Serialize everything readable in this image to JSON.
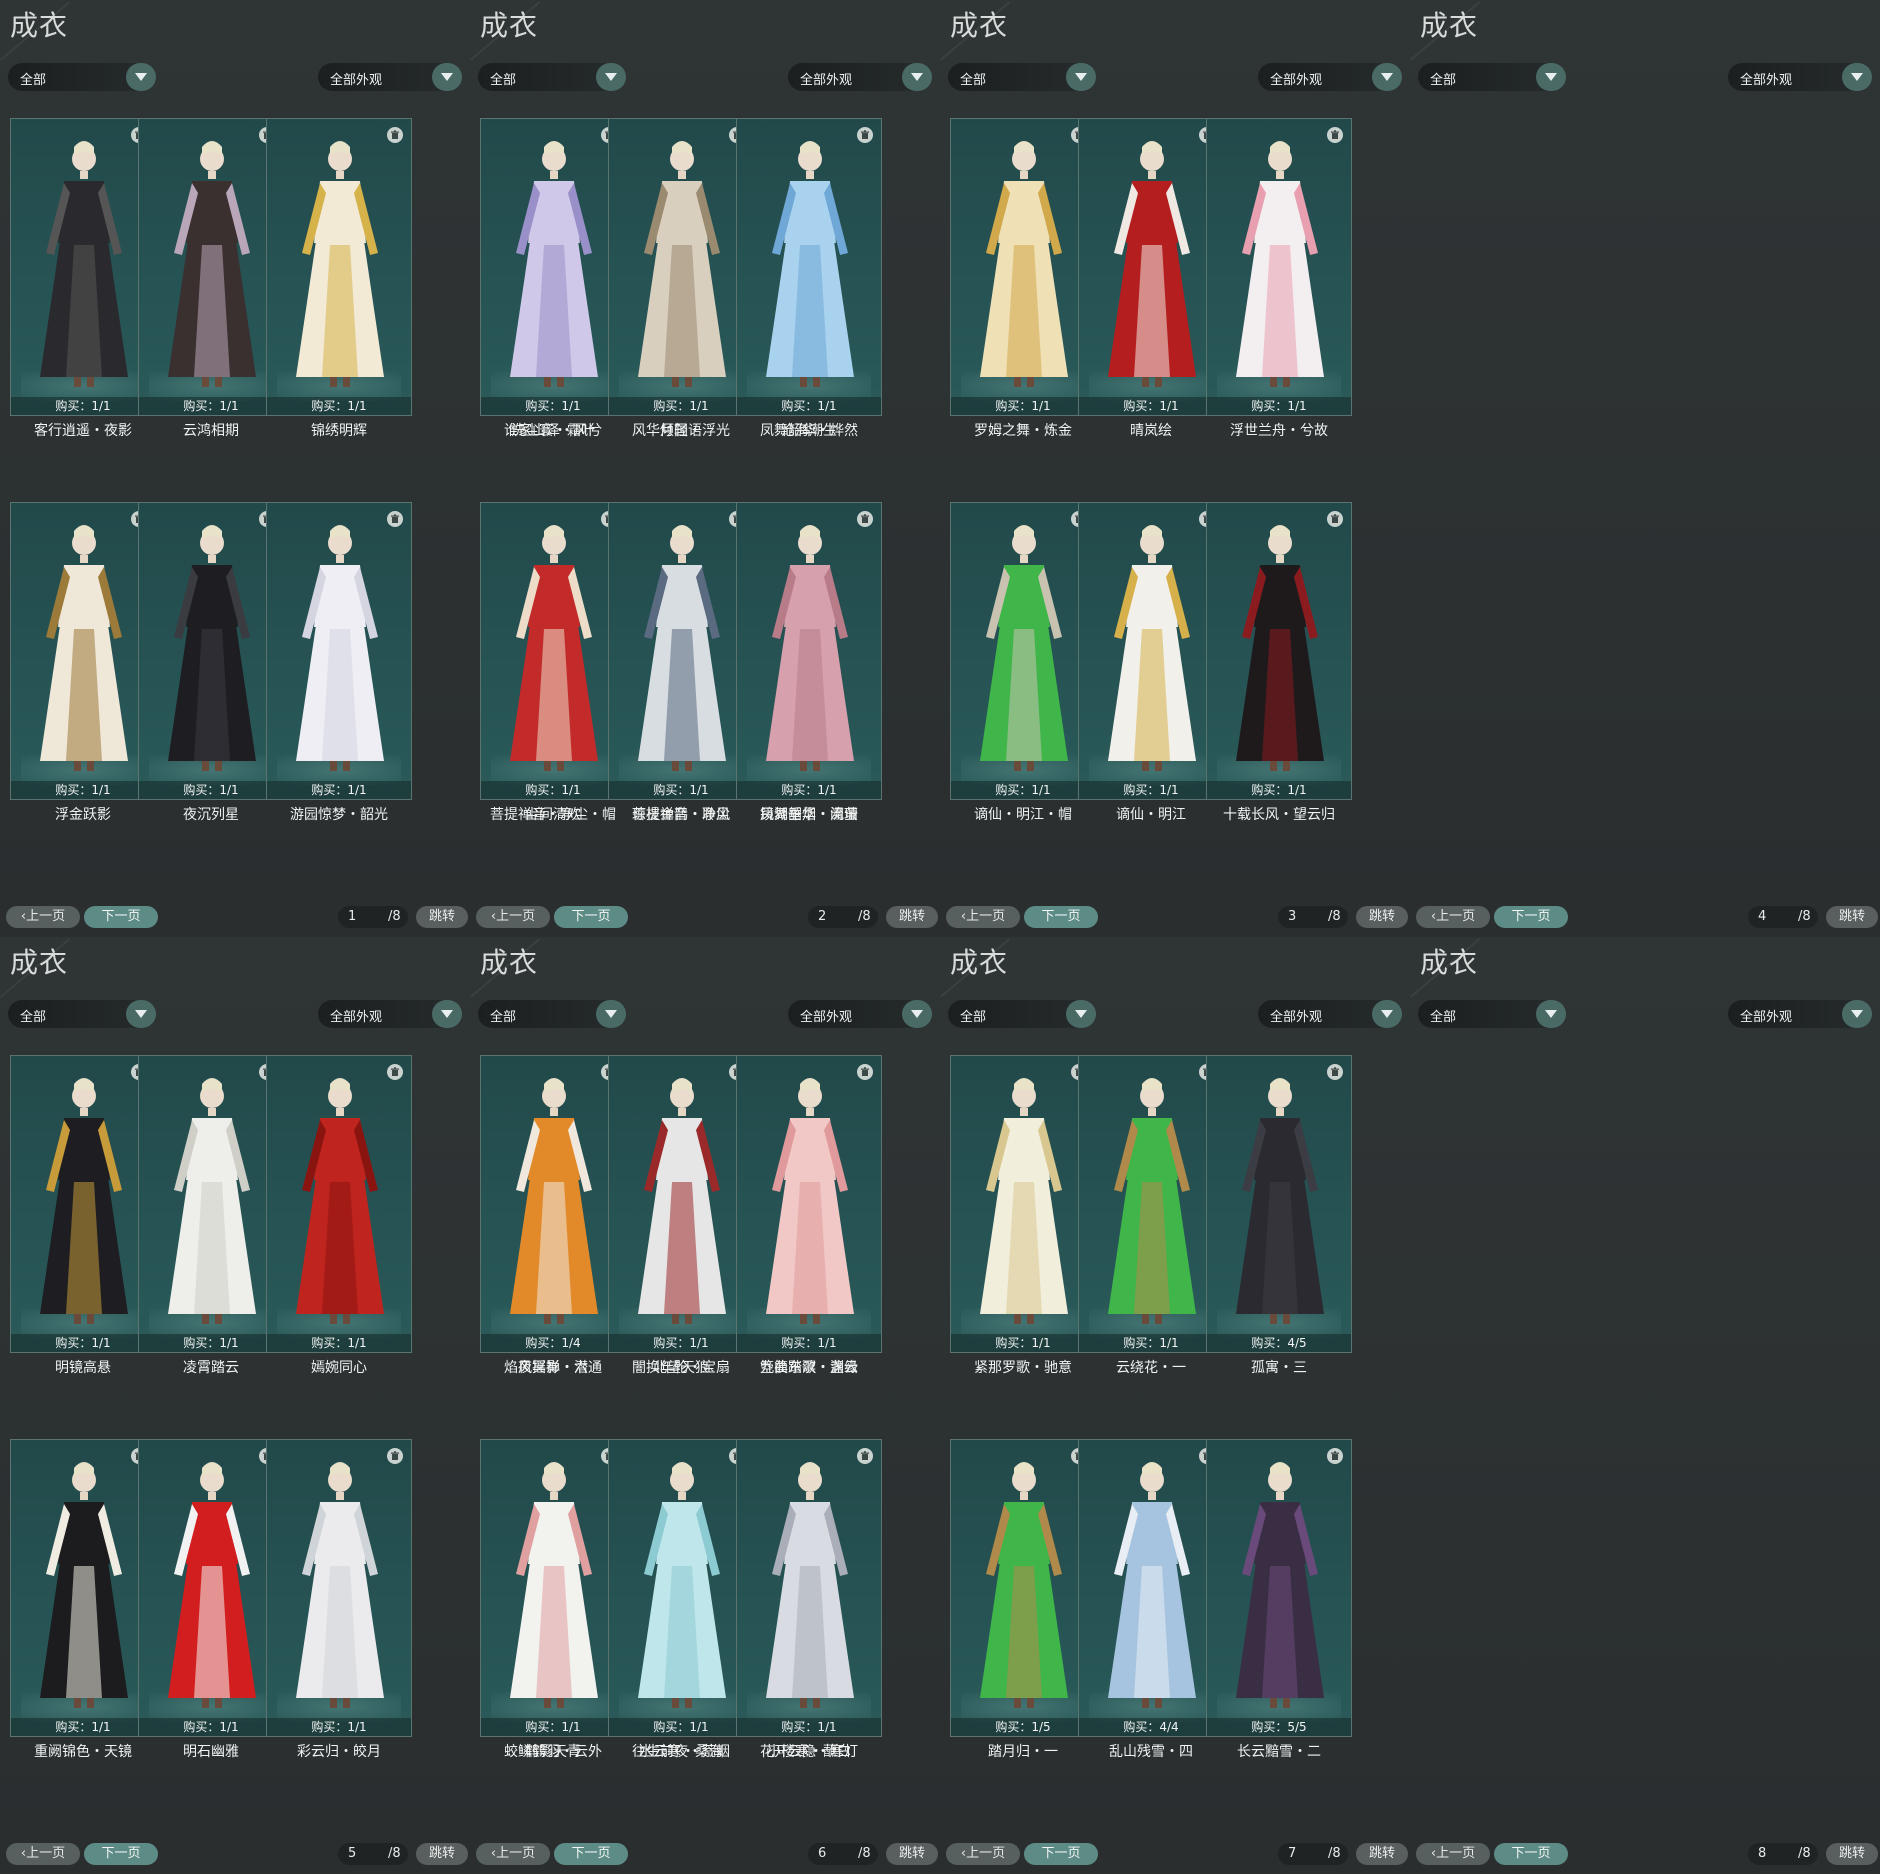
{
  "panel_title": "成衣",
  "filter_category": "全部",
  "filter_appearance": "全部外观",
  "prev_label": "上一页",
  "next_label": "下一页",
  "jump_label": "跳转",
  "total_pages": "/8",
  "colors": {
    "card_bg": "#265354",
    "accent": "#5d8c86",
    "panel_bg": "#2b2f30"
  },
  "icons": {
    "dropdown": "chevron-down-icon",
    "delete": "trash-icon"
  },
  "panels": [
    {
      "page": "1",
      "items": [
        {
          "name": "客行逍遥・夜影",
          "buy": "购买：1/1",
          "colors": [
            "#2a2a2e",
            "#555"
          ]
        },
        {
          "name": "云鸿相期",
          "buy": "购买：1/1",
          "colors": [
            "#3a3030",
            "#b9a6b8"
          ]
        },
        {
          "name": "锦绣明辉",
          "buy": "购买：1/1",
          "colors": [
            "#f3ead6",
            "#d6b24a"
          ]
        },
        {
          "name": "谁家山泽・风兮",
          "buy": "购买：1/1",
          "colors": [
            "#cfc8e8",
            "#9a90c9"
          ]
        },
        {
          "name": "月轻语",
          "buy": "购买：1/1",
          "colors": [
            "#d9cfbf",
            "#9a8a70"
          ]
        },
        {
          "name": "沧海潮生",
          "buy": "购买：1/1",
          "colors": [
            "#a9d2ee",
            "#6fa7d6"
          ]
        },
        {
          "name": "浮金跃影",
          "buy": "购买：1/1",
          "colors": [
            "#efe7d8",
            "#9c7a3a"
          ]
        },
        {
          "name": "夜沉列星",
          "buy": "购买：1/1",
          "colors": [
            "#1e1e22",
            "#3b3b42"
          ]
        },
        {
          "name": "游园惊梦・韶光",
          "buy": "购买：1/1",
          "colors": [
            "#eeeef4",
            "#d5d5e2"
          ]
        },
        {
          "name": "尘间清欢",
          "buy": "购买：1/1",
          "colors": [
            "#c32a2a",
            "#ecdcc8"
          ]
        },
        {
          "name": "琼枝金鹊・聆风",
          "buy": "购买：1/1",
          "colors": [
            "#d8dde2",
            "#5a6a80"
          ]
        },
        {
          "name": "凤舞韶华・流萤",
          "buy": "购买：1/1",
          "colors": [
            "#d6a0ad",
            "#b87b88"
          ]
        }
      ]
    },
    {
      "page": "2",
      "items": [
        {
          "name": "洗尘寰・霜叶",
          "buy": "购买：1/1",
          "colors": [
            "#dbe6f2",
            "#b5c9e0"
          ]
        },
        {
          "name": "风华倾国・浮光",
          "buy": "购买：1/1",
          "colors": [
            "#f1c3cf",
            "#e593a9"
          ]
        },
        {
          "name": "凤舞韶华・烨然",
          "buy": "购买：1/1",
          "colors": [
            "#8a1c1c",
            "#5a1010"
          ]
        },
        {
          "name": "菩提禅音・净尘・帽",
          "buy": "购买：1/1",
          "colors": [
            "#3fb54a",
            "#b08a4a"
          ]
        },
        {
          "name": "菩提禅音・净尘",
          "buy": "购买：1/1",
          "colors": [
            "#f2f2f2",
            "#d9d9d9"
          ]
        },
        {
          "name": "镜湖垂烟・阑珊",
          "buy": "购买：1/1",
          "colors": [
            "#efe4c8",
            "#d9b84a"
          ]
        }
      ]
    },
    {
      "page": "3",
      "items": [
        {
          "name": "罗姆之舞・炼金",
          "buy": "购买：1/1",
          "colors": [
            "#efe0b6",
            "#d1a84a"
          ]
        },
        {
          "name": "晴岚绘",
          "buy": "购买：1/1",
          "colors": [
            "#b51e1e",
            "#f0e8e2"
          ]
        },
        {
          "name": "浮世兰舟・兮故",
          "buy": "购买：1/1",
          "colors": [
            "#f3eef0",
            "#e8a0b0"
          ]
        },
        {
          "name": "谪仙・明江・帽",
          "buy": "购买：1/1",
          "colors": [
            "#3fb54a",
            "#c9c2b0"
          ]
        },
        {
          "name": "谪仙・明江",
          "buy": "购买：1/1",
          "colors": [
            "#f2f0ea",
            "#d6b04a"
          ]
        },
        {
          "name": "十载长风・望云归",
          "buy": "购买：1/1",
          "colors": [
            "#1e1a1c",
            "#8a1c20"
          ]
        }
      ]
    },
    {
      "page": "4",
      "items": []
    },
    {
      "page": "5",
      "items": [
        {
          "name": "明镜高悬",
          "buy": "购买：1/1",
          "colors": [
            "#1e1e22",
            "#c79a3a"
          ]
        },
        {
          "name": "凌霄踏云",
          "buy": "购买：1/1",
          "colors": [
            "#eeeeea",
            "#cfcfc8"
          ]
        },
        {
          "name": "嫣婉同心",
          "buy": "购买：1/1",
          "colors": [
            "#c0241e",
            "#8a1410"
          ]
        },
        {
          "name": "风摇影・六",
          "buy": "购买：1/4",
          "colors": [
            "#e28a2a",
            "#f0e8dc"
          ]
        },
        {
          "name": "北望天狼",
          "buy": "购买：1/1",
          "colors": [
            "#e6e6e6",
            "#9a2a2a"
          ]
        },
        {
          "name": "箜篌踏歌・盏云",
          "buy": "购买：1/1",
          "colors": [
            "#f1c8c6",
            "#e09a9c"
          ]
        },
        {
          "name": "重阙锦色・天镜",
          "buy": "购买：1/1",
          "colors": [
            "#1c1c1e",
            "#f0ece2"
          ]
        },
        {
          "name": "明石幽雅",
          "buy": "购买：1/1",
          "colors": [
            "#d21e1e",
            "#f2f2f2"
          ]
        },
        {
          "name": "彩云归・皎月",
          "buy": "购买：1/1",
          "colors": [
            "#ebebee",
            "#cfd4d8"
          ]
        },
        {
          "name": "鹤影天青",
          "buy": "购买：1/1",
          "colors": [
            "#f2f2ef",
            "#e0a0a0"
          ]
        },
        {
          "name": "水云寒・桑海",
          "buy": "购买：1/1",
          "colors": [
            "#bfe6ea",
            "#8ccbd2"
          ]
        },
        {
          "name": "小楼寒・蘸白",
          "buy": "购买：1/1",
          "colors": [
            "#d8dce2",
            "#a9aeb8"
          ]
        }
      ]
    },
    {
      "page": "6",
      "items": [
        {
          "name": "焰夜冥禅・潜通",
          "buy": "购买：1/1",
          "colors": [
            "#c81e1e",
            "#1e1e22"
          ]
        },
        {
          "name": "闇换年轮・宝扇",
          "buy": "购买：1/1",
          "colors": [
            "#1e2440",
            "#e6e6e6"
          ]
        },
        {
          "name": "九曲东溟・渊缘",
          "buy": "购买：1/1",
          "colors": [
            "#2a2e38",
            "#4a5060"
          ]
        },
        {
          "name": "蛟鳞鹤羽・云外",
          "buy": "购买：1/1",
          "colors": [
            "#c8d0b8",
            "#3a2e2a"
          ]
        },
        {
          "name": "往生前夜・荒烟",
          "buy": "购买：1/1",
          "colors": [
            "#1c1a1a",
            "#f0ece6"
          ]
        },
        {
          "name": "花开云隐・寒灯",
          "buy": "购买：1/1",
          "colors": [
            "#a8c8ee",
            "#e6eef8"
          ]
        }
      ]
    },
    {
      "page": "7",
      "items": [
        {
          "name": "紧那罗歌・驰意",
          "buy": "购买：1/1",
          "colors": [
            "#f2eedc",
            "#d8c890"
          ]
        },
        {
          "name": "云绕花・一",
          "buy": "购买：1/1",
          "colors": [
            "#3fb54a",
            "#b08a4a"
          ]
        },
        {
          "name": "孤寓・三",
          "buy": "购买：4/5",
          "colors": [
            "#2a2a30",
            "#3c3c44"
          ]
        },
        {
          "name": "踏月归・一",
          "buy": "购买：1/5",
          "colors": [
            "#3fb54a",
            "#b08a4a"
          ]
        },
        {
          "name": "乱山残雪・四",
          "buy": "购买：4/4",
          "colors": [
            "#a6c4e0",
            "#e8eef4"
          ]
        },
        {
          "name": "长云黯雪・二",
          "buy": "购买：5/5",
          "colors": [
            "#3a2e44",
            "#6a4a7a"
          ]
        }
      ]
    },
    {
      "page": "8",
      "items": []
    }
  ]
}
